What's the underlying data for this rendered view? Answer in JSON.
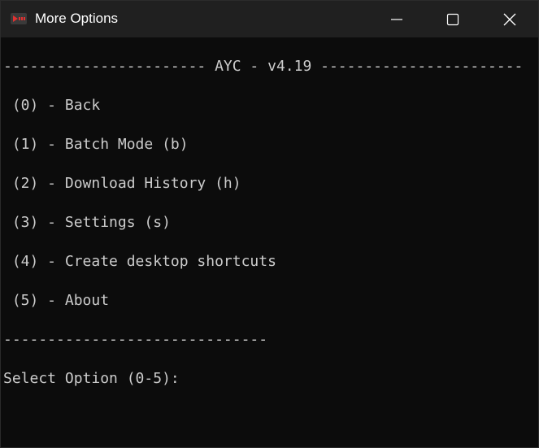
{
  "window": {
    "title": "More Options",
    "icon": "ayc-app-icon",
    "controls": {
      "minimize_icon": "minimize-icon",
      "maximize_icon": "maximize-icon",
      "close_icon": "close-icon"
    }
  },
  "console": {
    "header": "----------------------- AYC - v4.19 -----------------------",
    "menu": [
      " (0) - Back",
      " (1) - Batch Mode (b)",
      " (2) - Download History (h)",
      " (3) - Settings (s)",
      " (4) - Create desktop shortcuts",
      " (5) - About"
    ],
    "separator": "------------------------------",
    "prompt": "Select Option (0-5):"
  },
  "colors": {
    "console_bg": "#0c0c0c",
    "console_text": "#cccccc",
    "titlebar_bg": "#202020",
    "icon_red": "#e03131"
  }
}
